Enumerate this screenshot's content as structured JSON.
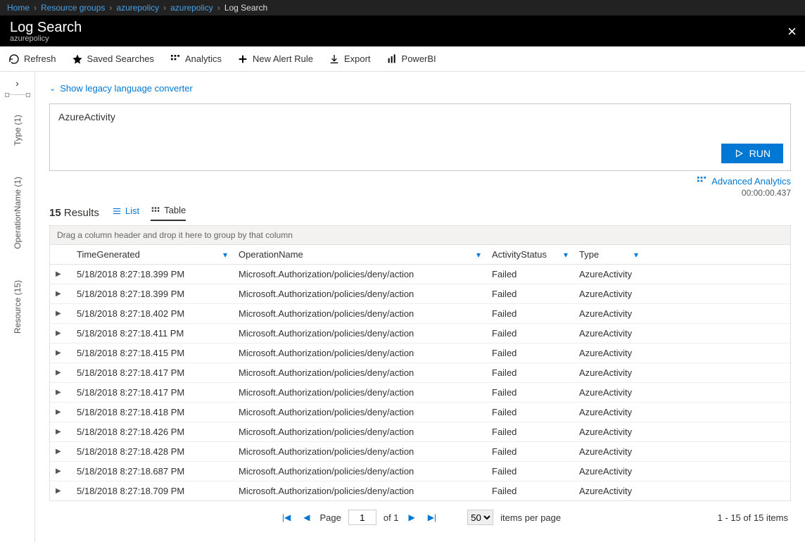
{
  "breadcrumb": [
    "Home",
    "Resource groups",
    "azurepolicy",
    "azurepolicy",
    "Log Search"
  ],
  "header": {
    "title": "Log Search",
    "subtitle": "azurepolicy"
  },
  "toolbar": {
    "refresh": "Refresh",
    "saved": "Saved Searches",
    "analytics": "Analytics",
    "newAlert": "New Alert Rule",
    "export": "Export",
    "powerbi": "PowerBI"
  },
  "sidebar": {
    "tabs": [
      "Type (1)",
      "OperationName (1)",
      "Resource (15)"
    ]
  },
  "legacyLink": "Show legacy language converter",
  "query": "AzureActivity",
  "runLabel": "RUN",
  "advancedAnalytics": "Advanced Analytics",
  "elapsed": "00:00:00.437",
  "results": {
    "count": "15",
    "label": "Results",
    "list": "List",
    "table": "Table"
  },
  "groupHint": "Drag a column header and drop it here to group by that column",
  "columns": [
    "TimeGenerated",
    "OperationName",
    "ActivityStatus",
    "Type"
  ],
  "rows": [
    {
      "time": "5/18/2018 8:27:18.399 PM",
      "op": "Microsoft.Authorization/policies/deny/action",
      "status": "Failed",
      "type": "AzureActivity"
    },
    {
      "time": "5/18/2018 8:27:18.399 PM",
      "op": "Microsoft.Authorization/policies/deny/action",
      "status": "Failed",
      "type": "AzureActivity"
    },
    {
      "time": "5/18/2018 8:27:18.402 PM",
      "op": "Microsoft.Authorization/policies/deny/action",
      "status": "Failed",
      "type": "AzureActivity"
    },
    {
      "time": "5/18/2018 8:27:18.411 PM",
      "op": "Microsoft.Authorization/policies/deny/action",
      "status": "Failed",
      "type": "AzureActivity"
    },
    {
      "time": "5/18/2018 8:27:18.415 PM",
      "op": "Microsoft.Authorization/policies/deny/action",
      "status": "Failed",
      "type": "AzureActivity"
    },
    {
      "time": "5/18/2018 8:27:18.417 PM",
      "op": "Microsoft.Authorization/policies/deny/action",
      "status": "Failed",
      "type": "AzureActivity"
    },
    {
      "time": "5/18/2018 8:27:18.417 PM",
      "op": "Microsoft.Authorization/policies/deny/action",
      "status": "Failed",
      "type": "AzureActivity"
    },
    {
      "time": "5/18/2018 8:27:18.418 PM",
      "op": "Microsoft.Authorization/policies/deny/action",
      "status": "Failed",
      "type": "AzureActivity"
    },
    {
      "time": "5/18/2018 8:27:18.426 PM",
      "op": "Microsoft.Authorization/policies/deny/action",
      "status": "Failed",
      "type": "AzureActivity"
    },
    {
      "time": "5/18/2018 8:27:18.428 PM",
      "op": "Microsoft.Authorization/policies/deny/action",
      "status": "Failed",
      "type": "AzureActivity"
    },
    {
      "time": "5/18/2018 8:27:18.687 PM",
      "op": "Microsoft.Authorization/policies/deny/action",
      "status": "Failed",
      "type": "AzureActivity"
    },
    {
      "time": "5/18/2018 8:27:18.709 PM",
      "op": "Microsoft.Authorization/policies/deny/action",
      "status": "Failed",
      "type": "AzureActivity"
    }
  ],
  "pager": {
    "pageLabel": "Page",
    "page": "1",
    "ofLabel": "of 1",
    "perPage": "50",
    "perPageLabel": "items per page",
    "summary": "1 - 15 of 15 items"
  }
}
